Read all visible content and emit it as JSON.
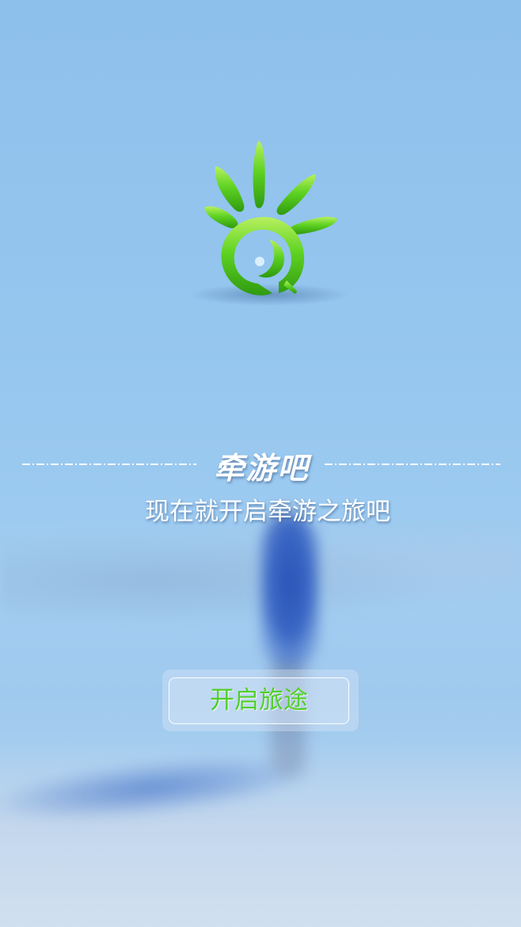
{
  "app": {
    "brand_title": "牵游吧",
    "slogan": "现在就开启牵游之旅吧",
    "logo_icon": "sun-eye-logo-icon"
  },
  "actions": {
    "start_label": "开启旅途"
  },
  "colors": {
    "background": "#93c5ee",
    "logo_green": "#5fd322",
    "button_text": "#52cf2a",
    "text": "#ffffff"
  }
}
